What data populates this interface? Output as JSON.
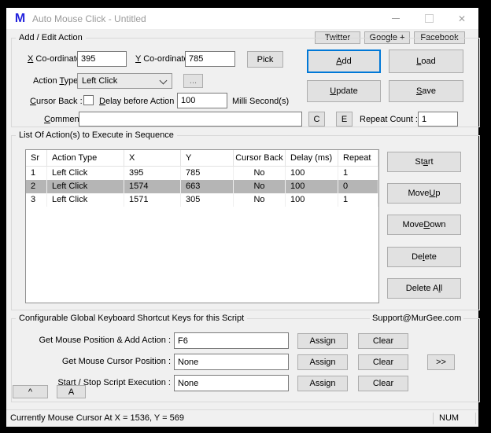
{
  "window": {
    "title": "Auto Mouse Click - Untitled",
    "logo_letter": "M",
    "icons": {
      "minimize": "minimize",
      "maximize": "maximize",
      "close": "✕"
    }
  },
  "social": {
    "twitter": "Twitter",
    "google_plus": "Google +",
    "facebook": "Facebook"
  },
  "add_edit": {
    "group_label": "Add / Edit Action",
    "x_label": {
      "text": "X Co-ordinate :",
      "u": 0
    },
    "x_value": "395",
    "y_label": {
      "text": "Y Co-ordinate :",
      "u": 0
    },
    "y_value": "785",
    "pick_label": "Pick",
    "action_type_label": {
      "text": "Action Type :",
      "u": 7
    },
    "action_type_value": "Left Click",
    "more_options_label": "...",
    "cursor_back_label": {
      "text": "Cursor Back :",
      "u": 0
    },
    "cursor_back_checked": false,
    "delay_label": {
      "text": "Delay before Action :",
      "u": 0
    },
    "delay_value": "100",
    "delay_unit_label": "Milli Second(s)",
    "comment_label": {
      "text": "Comment :",
      "u": 0
    },
    "comment_value": "",
    "c_button_label": "C",
    "e_button_label": "E",
    "repeat_count_label": "Repeat Count :",
    "repeat_count_value": "1",
    "add_label": {
      "text": "Add",
      "u": 0
    },
    "load_label": {
      "text": "Load",
      "u": 0
    },
    "update_label": {
      "text": "Update",
      "u": 0
    },
    "save_label": {
      "text": "Save",
      "u": 0
    }
  },
  "action_list": {
    "group_label": "List Of Action(s) to Execute in Sequence",
    "columns": [
      "Sr",
      "Action Type",
      "X",
      "Y",
      "Cursor Back",
      "Delay (ms)",
      "Repeat"
    ],
    "rows": [
      {
        "sr": "1",
        "action": "Left Click",
        "x": "395",
        "y": "785",
        "cursor_back": "No",
        "delay": "100",
        "repeat": "1",
        "selected": false
      },
      {
        "sr": "2",
        "action": "Left Click",
        "x": "1574",
        "y": "663",
        "cursor_back": "No",
        "delay": "100",
        "repeat": "0",
        "selected": true
      },
      {
        "sr": "3",
        "action": "Left Click",
        "x": "1571",
        "y": "305",
        "cursor_back": "No",
        "delay": "100",
        "repeat": "1",
        "selected": false
      }
    ],
    "buttons": {
      "start": {
        "text": "Start",
        "u": 2
      },
      "move_up": {
        "text": "Move Up",
        "u": 5
      },
      "move_down": {
        "text": "Move Down",
        "u": 5
      },
      "delete": {
        "text": "Delete",
        "u": 2
      },
      "delete_all": {
        "text": "Delete All",
        "u": 8
      }
    }
  },
  "shortcuts": {
    "group_label": "Configurable Global Keyboard Shortcut Keys for this Script",
    "support_label": "Support@MurGee.com",
    "rows": [
      {
        "label": "Get Mouse Position & Add Action :",
        "value": "F6"
      },
      {
        "label": "Get Mouse Cursor Position :",
        "value": "None"
      },
      {
        "label": "Start / Stop Script Execution :",
        "value": "None"
      }
    ],
    "assign_label": "Assign",
    "clear_label": "Clear",
    "more_label": ">>",
    "caret_button_label": "^",
    "a_button_label": "A"
  },
  "statusbar": {
    "text": "Currently Mouse Cursor At X = 1536, Y = 569",
    "num": "NUM"
  },
  "colors": {
    "selected_row": "#b5b5b5",
    "focus_border": "#0078d7",
    "logo_blue": "#2424dd"
  }
}
